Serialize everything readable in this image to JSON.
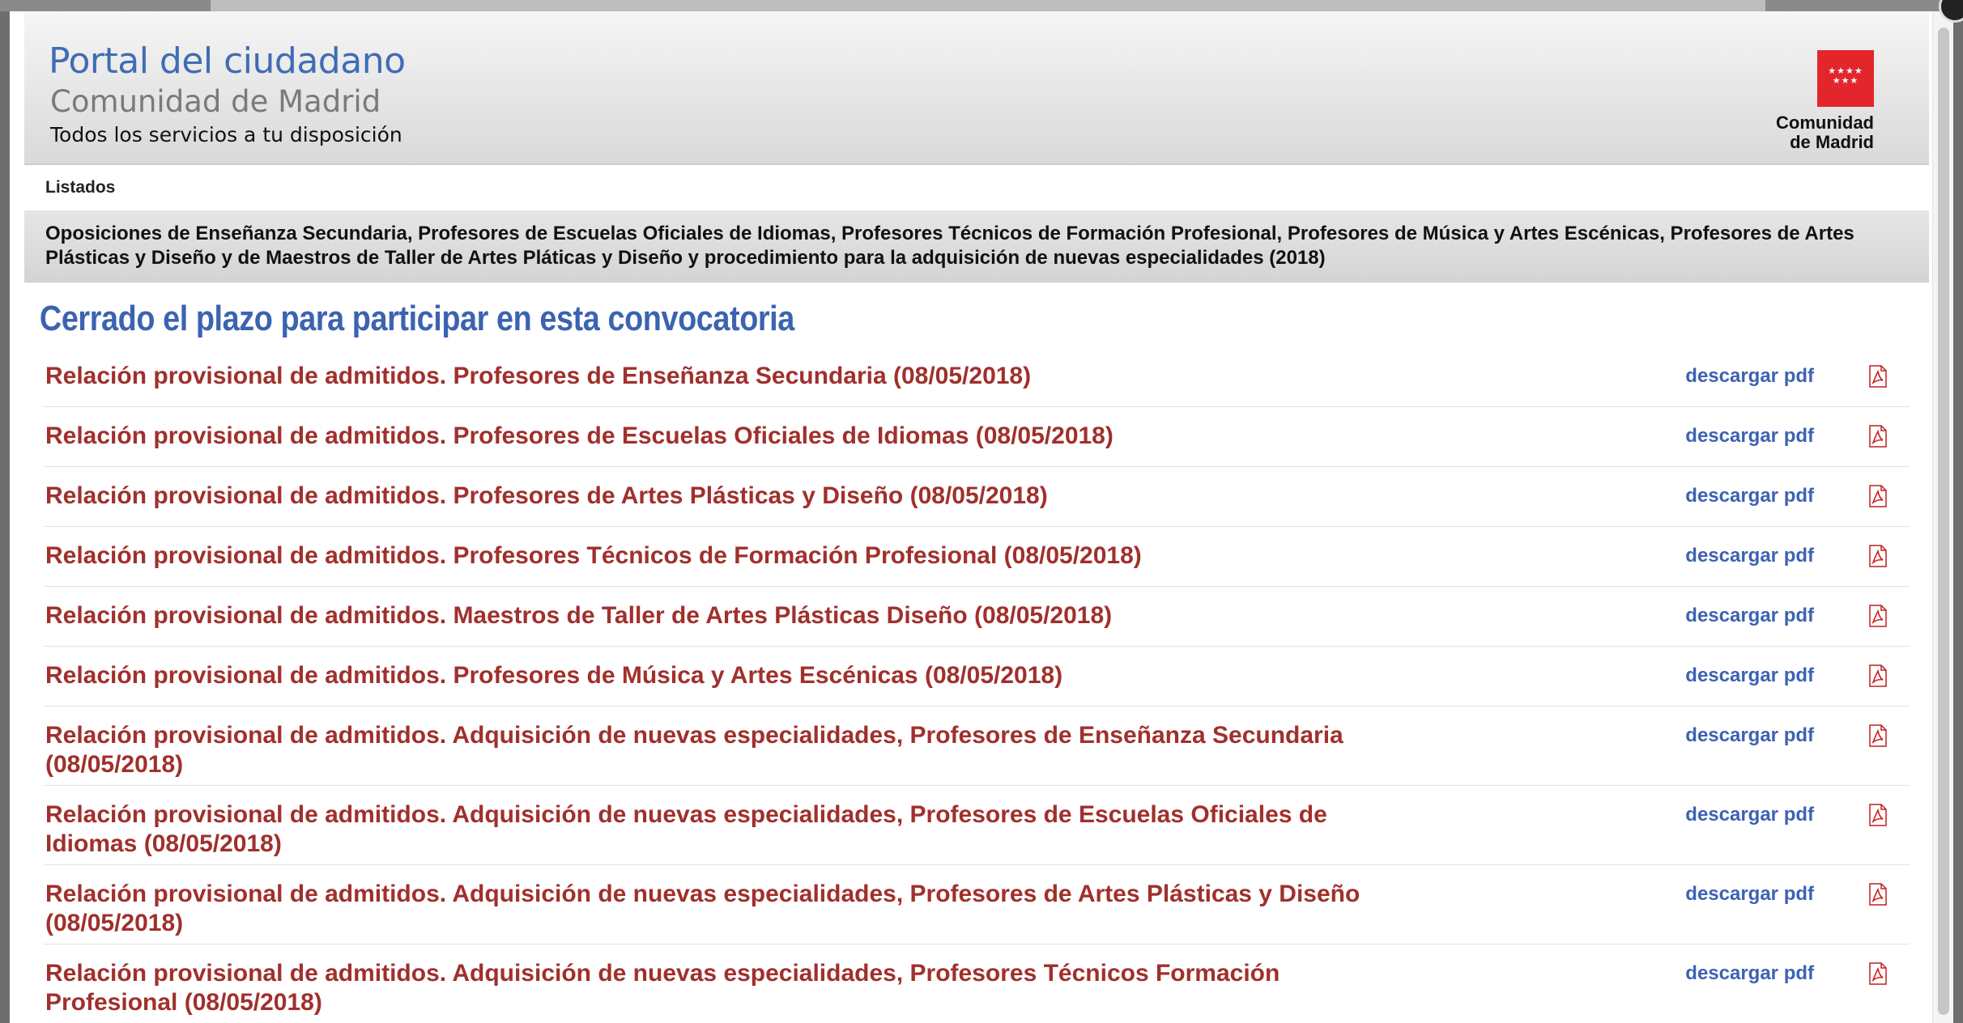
{
  "header": {
    "title": "Portal del ciudadano",
    "subtitle": "Comunidad de Madrid",
    "tagline": "Todos los servicios a tu disposición",
    "logo_text_1": "Comunidad",
    "logo_text_2": "de Madrid",
    "logo_stars": "★★★★ ★★★",
    "brand_color": "#e3262c"
  },
  "listados_label": "Listados",
  "convocatoria_title": "Oposiciones de Enseñanza Secundaria, Profesores de Escuelas Oficiales de Idiomas, Profesores Técnicos de Formación Profesional, Profesores de Música y Artes Escénicas, Profesores de Artes Plásticas y Diseño y de Maestros de Taller de Artes Pláticas y Diseño y procedimiento para la adquisición de nuevas especialidades (2018)",
  "status_heading": "Cerrado el plazo para participar en esta convocatoria",
  "download_label": "descargar pdf",
  "items": [
    {
      "title": "Relación provisional de admitidos. Profesores de Enseñanza Secundaria (08/05/2018)"
    },
    {
      "title": "Relación provisional de admitidos. Profesores de Escuelas Oficiales de Idiomas (08/05/2018)"
    },
    {
      "title": "Relación provisional de admitidos. Profesores de Artes Plásticas y Diseño (08/05/2018)"
    },
    {
      "title": "Relación provisional de admitidos. Profesores Técnicos de Formación Profesional (08/05/2018)"
    },
    {
      "title": "Relación provisional de admitidos. Maestros de Taller de Artes Plásticas Diseño (08/05/2018)"
    },
    {
      "title": "Relación provisional de admitidos. Profesores de Música y Artes Escénicas (08/05/2018)"
    },
    {
      "title": "Relación provisional de admitidos. Adquisición de nuevas especialidades, Profesores de Enseñanza Secundaria (08/05/2018)"
    },
    {
      "title": "Relación provisional de admitidos. Adquisición de nuevas especialidades, Profesores de Escuelas Oficiales de Idiomas (08/05/2018)"
    },
    {
      "title": "Relación provisional de admitidos. Adquisición de nuevas especialidades, Profesores de Artes Plásticas y Diseño (08/05/2018)"
    },
    {
      "title": "Relación provisional de admitidos. Adquisición de nuevas especialidades, Profesores Técnicos Formación Profesional (08/05/2018)"
    }
  ],
  "colors": {
    "item_title": "#a0302c",
    "link": "#3d62b3",
    "heading": "#3b63b0"
  }
}
